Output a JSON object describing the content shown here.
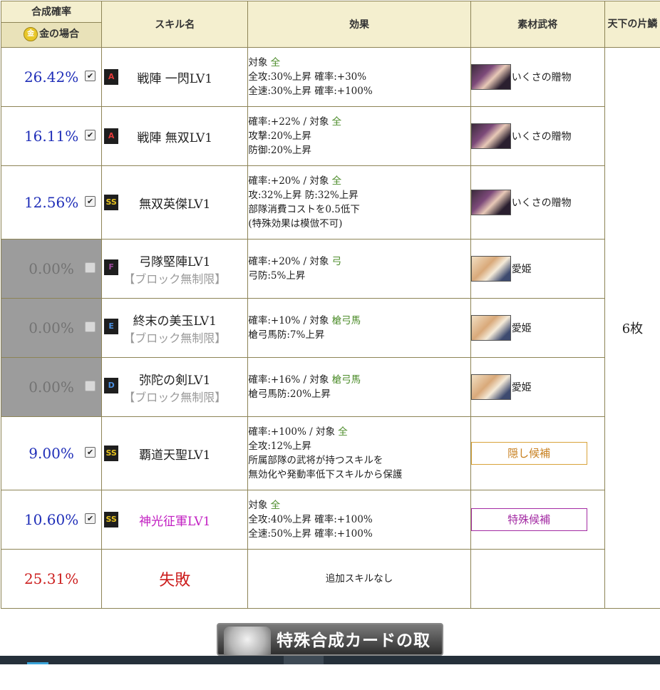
{
  "header": {
    "rate_label": "合成確率",
    "gold_icon": "金",
    "gold_label": "金の場合",
    "skill_label": "スキル名",
    "effect_label": "効果",
    "material_label": "素材武将",
    "tenka_label": "天下の片鱗"
  },
  "rows": [
    {
      "rate": "26.42%",
      "checked": true,
      "grade": "A",
      "grade_color": "#e23a3a",
      "name": "戦陣 一閃LV1",
      "effect": [
        [
          "対象 ",
          "全"
        ],
        [
          "全攻:30%上昇 確率:+30%"
        ],
        [
          "全速:30%上昇 確率:+100%"
        ]
      ],
      "material": "いくさの贈物",
      "portrait": "iku"
    },
    {
      "rate": "16.11%",
      "checked": true,
      "grade": "A",
      "grade_color": "#e23a3a",
      "name": "戦陣 無双LV1",
      "effect": [
        [
          "確率:+22% / 対象 ",
          "全"
        ],
        [
          "攻撃:20%上昇"
        ],
        [
          "防御:20%上昇"
        ]
      ],
      "material": "いくさの贈物",
      "portrait": "iku"
    },
    {
      "rate": "12.56%",
      "checked": true,
      "grade": "SS",
      "grade_color": "#e6c21e",
      "name": "無双英傑LV1",
      "effect": [
        [
          "確率:+20% / 対象 ",
          "全"
        ],
        [
          "攻:32%上昇 防:32%上昇"
        ],
        [
          "部隊消費コストを0.5低下"
        ],
        [
          "(特殊効果は模倣不可)"
        ]
      ],
      "material": "いくさの贈物",
      "portrait": "iku"
    },
    {
      "rate": "0.00%",
      "checked": false,
      "disabled": true,
      "grade": "F",
      "grade_color": "#a04aa0",
      "name": "弓隊堅陣LV1",
      "blocked": "【ブロック無制限】",
      "effect": [
        [
          "確率:+20% / 対象 ",
          "弓"
        ],
        [
          "弓防:5%上昇"
        ]
      ],
      "material": "愛姫",
      "portrait": "ai"
    },
    {
      "rate": "0.00%",
      "checked": false,
      "disabled": true,
      "grade": "E",
      "grade_color": "#4a8fe0",
      "name": "終末の美玉LV1",
      "blocked": "【ブロック無制限】",
      "effect": [
        [
          "確率:+10% / 対象 ",
          "槍弓馬"
        ],
        [
          "槍弓馬防:7%上昇"
        ]
      ],
      "material": "愛姫",
      "portrait": "ai"
    },
    {
      "rate": "0.00%",
      "checked": false,
      "disabled": true,
      "grade": "D",
      "grade_color": "#4a8fe0",
      "name": "弥陀の剣LV1",
      "blocked": "【ブロック無制限】",
      "effect": [
        [
          "確率:+16% / 対象 ",
          "槍弓馬"
        ],
        [
          "槍弓馬防:20%上昇"
        ]
      ],
      "material": "愛姫",
      "portrait": "ai"
    },
    {
      "rate": "9.00%",
      "checked": true,
      "grade": "SS",
      "grade_color": "#e6c21e",
      "name": "覇道天聖LV1",
      "effect": [
        [
          "確率:+100% / 対象 ",
          "全"
        ],
        [
          "全攻:12%上昇"
        ],
        [
          "所属部隊の武将が持つスキルを"
        ],
        [
          "無効化や発動率低下スキルから保護"
        ]
      ],
      "material_button": "隠し候補",
      "material_button_type": "hidden"
    },
    {
      "rate": "10.60%",
      "checked": true,
      "grade": "SS",
      "grade_color": "#e6c21e",
      "name": "神光征軍LV1",
      "magenta": true,
      "effect": [
        [
          "対象 ",
          "全"
        ],
        [
          "全攻:40%上昇 確率:+100%"
        ],
        [
          "全速:50%上昇 確率:+100%"
        ]
      ],
      "material_button": "特殊候補",
      "material_button_type": "special"
    },
    {
      "rate": "25.31%",
      "fail": true,
      "name": "失敗",
      "effect_none": "追加スキルなし"
    }
  ],
  "tenka_value": "6枚",
  "cancel_button": "特殊合成カードの取消",
  "check_mark": "✔"
}
